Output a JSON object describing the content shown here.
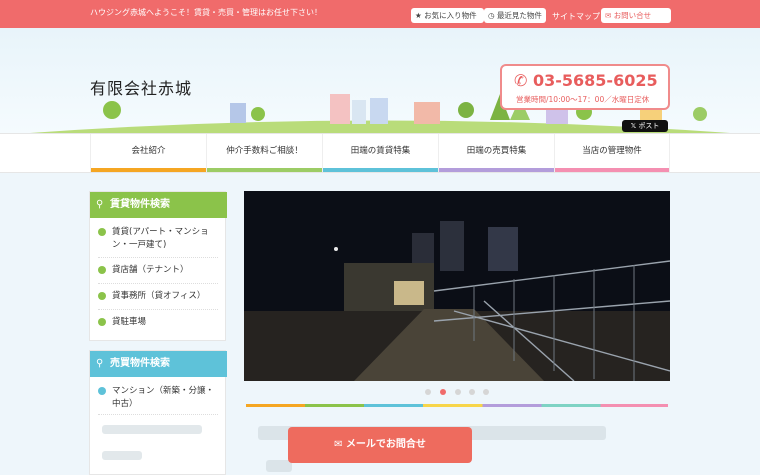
{
  "topbar": {
    "welcome": "ハウジング赤城へようこそ！賃貸・売買・管理はお任せ下さい！",
    "favorites": "お気に入り物件",
    "recent": "最近見た物件",
    "sitemap": "サイトマップ",
    "contact": "お問い合せ"
  },
  "header": {
    "company": "有限会社赤城",
    "phone": "03-5685-6025",
    "hours": "営業時間/10:00〜17：00／水曜日定休",
    "tweet": "ポスト"
  },
  "nav": {
    "items": [
      {
        "label": "会社紹介",
        "color": "#f5a623"
      },
      {
        "label": "仲介手数料ご相談！",
        "color": "#9ccc65"
      },
      {
        "label": "田端の賃貸特集",
        "color": "#5ec2d9"
      },
      {
        "label": "田端の売買特集",
        "color": "#b39ddb"
      },
      {
        "label": "当店の管理物件",
        "color": "#f48fb1"
      }
    ]
  },
  "rent": {
    "title": "賃貸物件検索",
    "items": [
      "賃貸(アパート・マンション・一戸建て)",
      "貸店舗（テナント）",
      "貸事務所（貸オフィス）",
      "貸駐車場"
    ]
  },
  "sale": {
    "title": "売買物件検索",
    "items": [
      "マンション（新築・分譲・中古）"
    ]
  },
  "cta": {
    "mail": "メールでお問合せ"
  },
  "colors": {
    "accent": "#f06b6b",
    "green": "#8bc34a",
    "blue": "#5ec2d9"
  }
}
